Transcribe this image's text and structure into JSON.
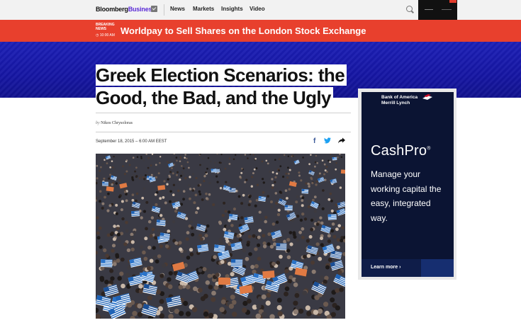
{
  "nav": {
    "logo_part1": "Bloomberg",
    "logo_part2": "Business",
    "items": [
      {
        "label": "News"
      },
      {
        "label": "Markets"
      },
      {
        "label": "Insights"
      },
      {
        "label": "Video"
      }
    ]
  },
  "breaking": {
    "tag_line1": "BREAKING",
    "tag_line2": "NEWS",
    "time": "10:00 AM",
    "headline": "Worldpay to Sell Shares on the London Stock Exchange"
  },
  "article": {
    "title": "Greek Election Scenarios: the Good, the Bad, and the Ugly",
    "byline_prefix": "by",
    "author": "Nikos Chrysoloras",
    "date": "September 18, 2015",
    "date_sep": "–",
    "time": "6:00 AM EEST"
  },
  "share": {
    "facebook_glyph": "f",
    "twitter_glyph": "🐦",
    "share_glyph": "➦"
  },
  "ad": {
    "brand_line1": "Bank of America",
    "brand_line2": "Merrill Lynch",
    "product": "CashPro",
    "product_mark": "®",
    "copy": "Manage your working capital the easy, integrated way.",
    "cta": "Learn more ›"
  },
  "colors": {
    "breaking_red": "#e8402d",
    "band_blue": "#1c1fb7",
    "ad_navy": "#0b1433",
    "brand_purple": "#5b2bd6"
  }
}
